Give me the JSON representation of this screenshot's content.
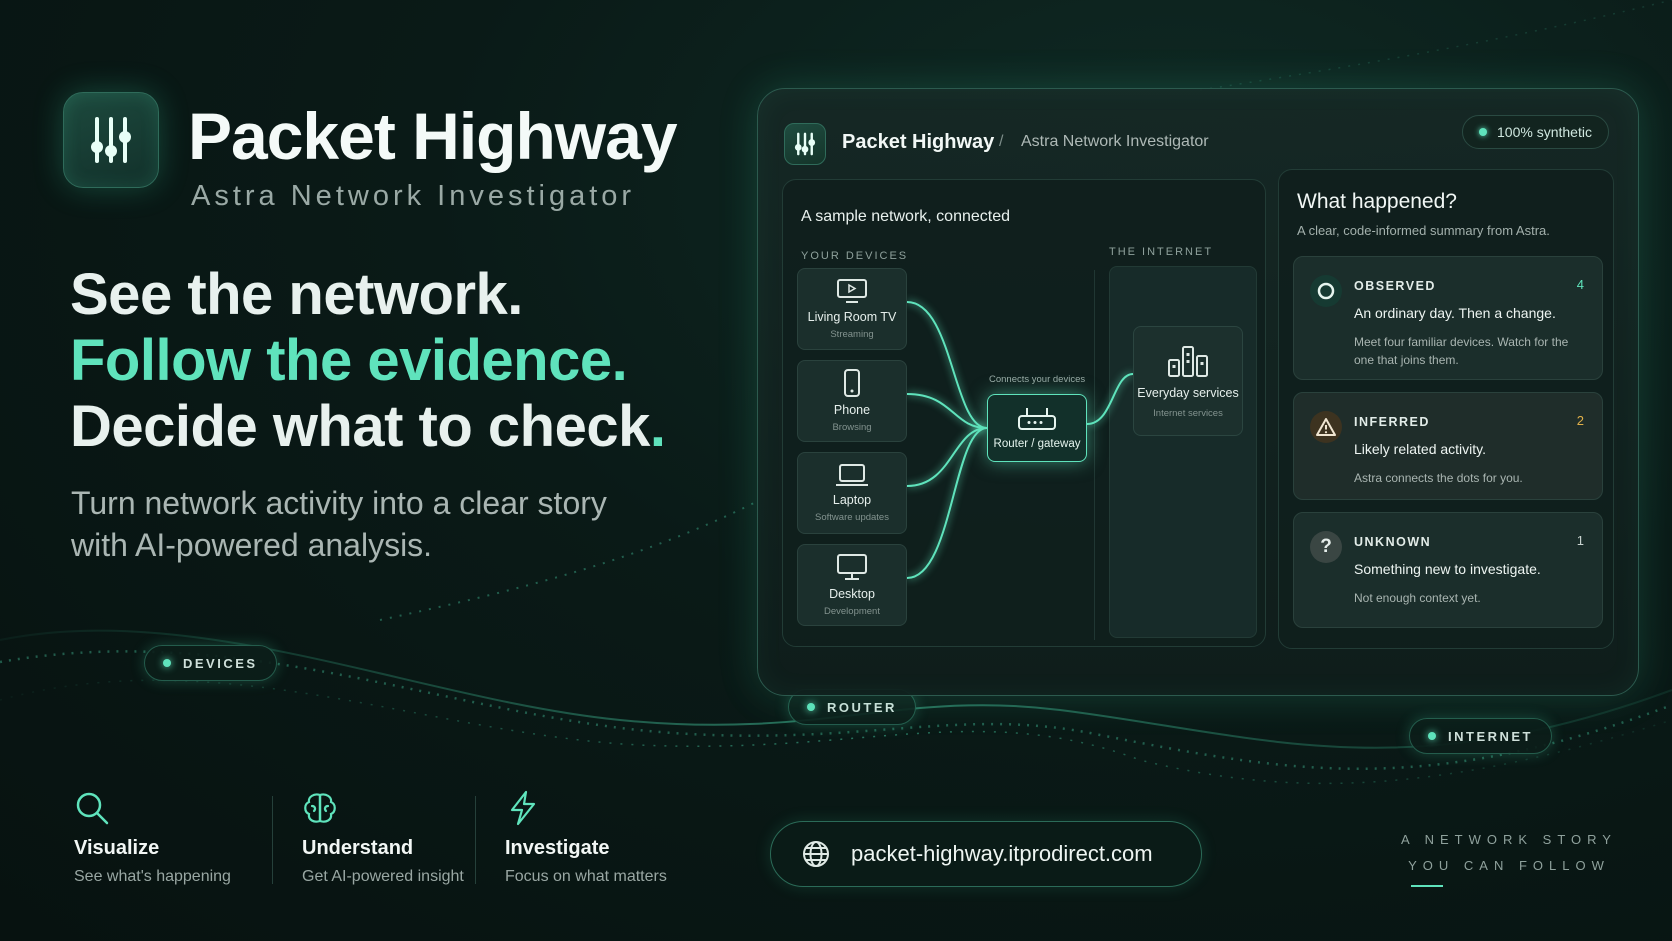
{
  "brand": {
    "title": "Packet Highway",
    "subtitle": "Astra Network Investigator"
  },
  "hero": {
    "line1": "See the network.",
    "line2": "Follow the evidence",
    "line2_dot": ".",
    "line3": "Decide what to check",
    "line3_dot": ".",
    "tagline_1": "Turn network activity into a clear story",
    "tagline_2": "with AI-powered analysis."
  },
  "wave_pills": [
    "DEVICES",
    "ROUTER",
    "INTERNET"
  ],
  "app": {
    "title": "Packet Highway",
    "separator": "/",
    "breadcrumb": "Astra Network Investigator",
    "badge": "100% synthetic",
    "network": {
      "title": "A sample network, connected",
      "devices_label": "YOUR DEVICES",
      "internet_label": "THE INTERNET",
      "devices": [
        {
          "name": "Living Room TV",
          "sub": "Streaming",
          "icon": "tv-icon"
        },
        {
          "name": "Phone",
          "sub": "Browsing",
          "icon": "phone-icon"
        },
        {
          "name": "Laptop",
          "sub": "Software updates",
          "icon": "laptop-icon"
        },
        {
          "name": "Desktop",
          "sub": "Development",
          "icon": "desktop-icon"
        }
      ],
      "router_caption": "Connects your devices",
      "router_name": "Router / gateway",
      "services_name": "Everyday services",
      "services_sub": "Internet services"
    },
    "what": {
      "title": "What happened?",
      "subtitle": "A clear, code-informed summary from Astra.",
      "cards": [
        {
          "label": "OBSERVED",
          "count": "4",
          "headline": "An ordinary day. Then a change.",
          "body": "Meet four familiar devices. Watch for the one that joins them.",
          "icon": "circle-icon",
          "color": "#5fe3bc"
        },
        {
          "label": "INFERRED",
          "count": "2",
          "headline": "Likely related activity.",
          "body": "Astra connects the dots for you.",
          "icon": "warning-icon",
          "color": "#e0b04a"
        },
        {
          "label": "UNKNOWN",
          "count": "1",
          "headline": "Something new to investigate.",
          "body": "Not enough context yet.",
          "icon": "question-icon",
          "color": "#c9d3d0"
        }
      ]
    }
  },
  "features": [
    {
      "title": "Visualize",
      "desc": "See what's happening",
      "icon": "search-icon"
    },
    {
      "title": "Understand",
      "desc": "Get AI-powered insight",
      "icon": "brain-icon"
    },
    {
      "title": "Investigate",
      "desc": "Focus on what matters",
      "icon": "lightning-icon"
    }
  ],
  "url": "packet-highway.itprodirect.com",
  "story_line1": "A NETWORK STORY",
  "story_line2": "YOU CAN FOLLOW",
  "colors": {
    "accent": "#5fe3bc",
    "warning": "#e0b04a",
    "background": "#0a1a17"
  }
}
